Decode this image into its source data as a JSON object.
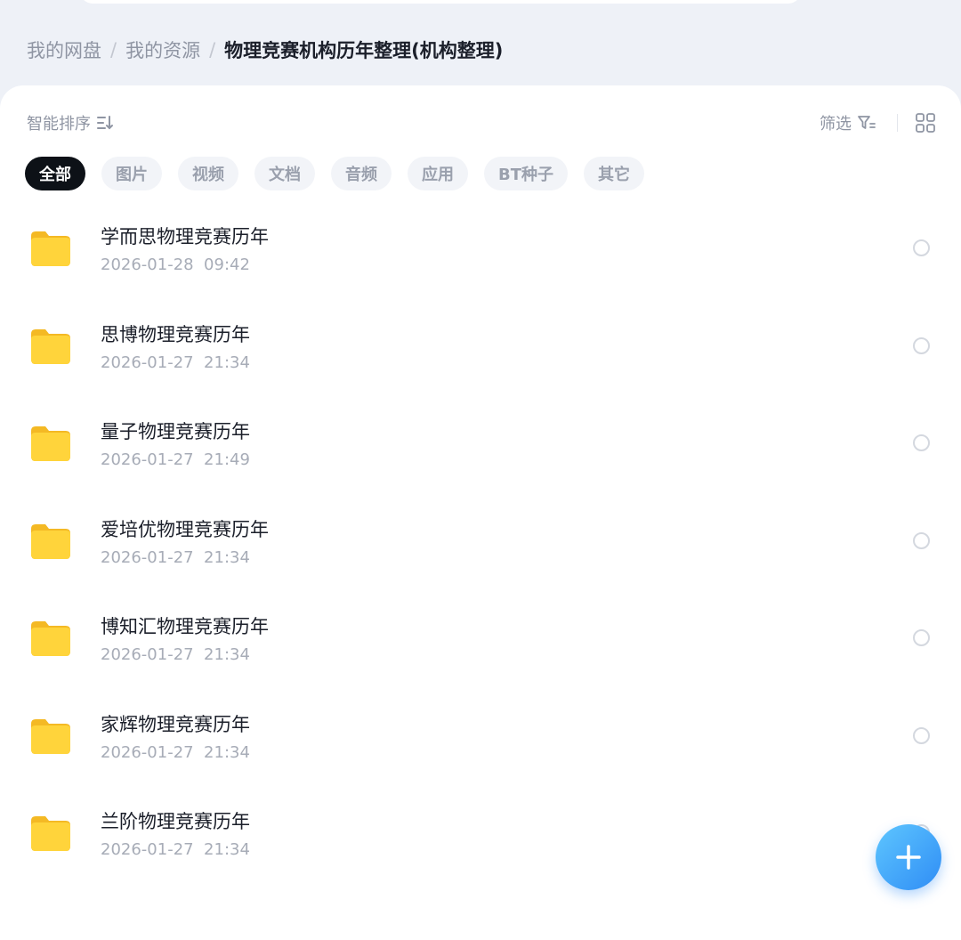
{
  "breadcrumb": {
    "items": [
      "我的网盘",
      "我的资源"
    ],
    "current": "物理竞赛机构历年整理(机构整理)",
    "separator": "/"
  },
  "toolbar": {
    "sort_label": "智能排序",
    "filter_label": "筛选"
  },
  "tabs": [
    "全部",
    "图片",
    "视频",
    "文档",
    "音频",
    "应用",
    "BT种子",
    "其它"
  ],
  "active_tab": "全部",
  "files": [
    {
      "name": "学而思物理竞赛历年",
      "date": "2026-01-28  09:42"
    },
    {
      "name": "思博物理竞赛历年",
      "date": "2026-01-27  21:34"
    },
    {
      "name": "量子物理竞赛历年",
      "date": "2026-01-27  21:49"
    },
    {
      "name": "爱培优物理竞赛历年",
      "date": "2026-01-27  21:34"
    },
    {
      "name": "博知汇物理竞赛历年",
      "date": "2026-01-27  21:34"
    },
    {
      "name": "家辉物理竞赛历年",
      "date": "2026-01-27  21:34"
    },
    {
      "name": "兰阶物理竞赛历年",
      "date": "2026-01-27  21:34"
    }
  ],
  "icons": {
    "sort": "sort-icon",
    "filter": "filter-icon",
    "view": "grid-view-icon",
    "file": "folder-icon",
    "fab": "plus-icon"
  },
  "colors": {
    "folder": "#FFD43B",
    "active_tab_bg": "#0D1117",
    "fab": "#2F8DF5"
  }
}
